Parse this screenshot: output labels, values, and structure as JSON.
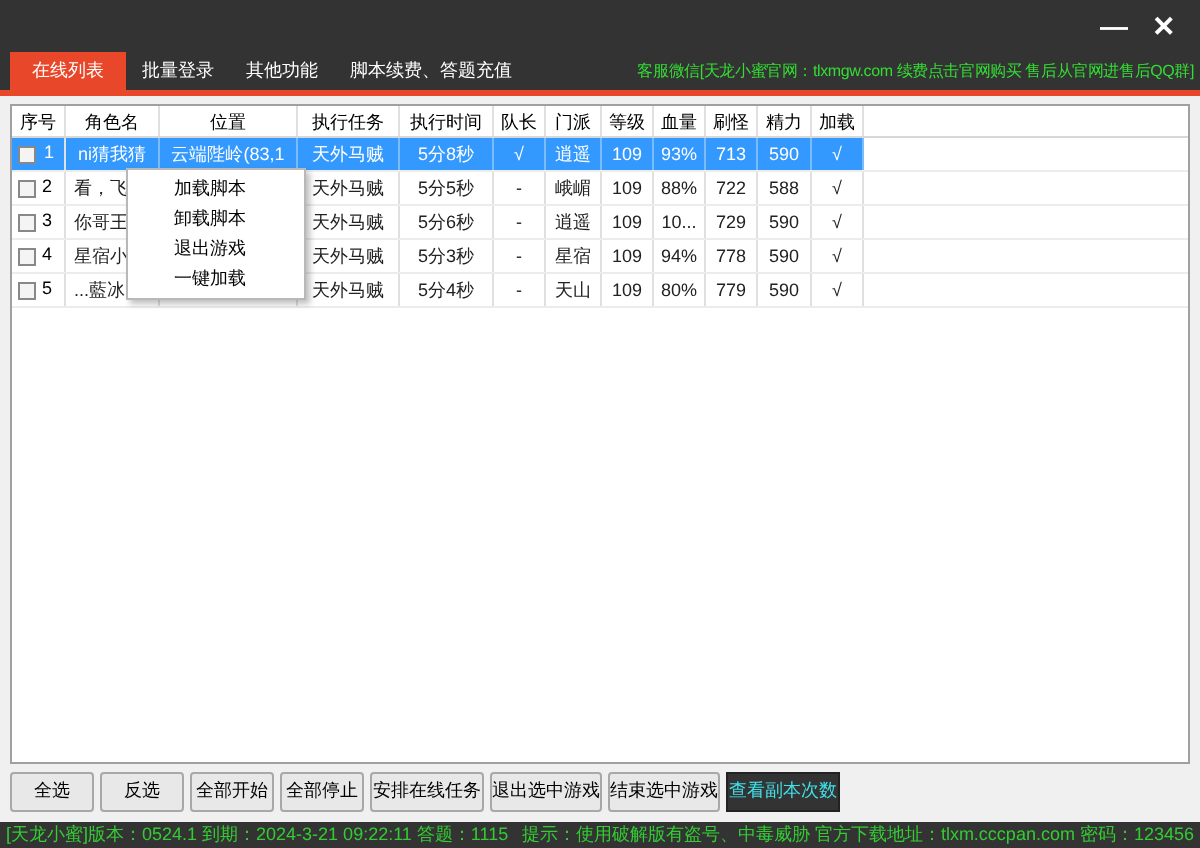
{
  "window": {
    "controls": [
      "—",
      "✕"
    ]
  },
  "tabs": [
    {
      "label": "在线列表",
      "selected": true
    },
    {
      "label": "批量登录",
      "selected": false
    },
    {
      "label": "其他功能",
      "selected": false
    },
    {
      "label": "脚本续费、答题充值",
      "selected": false
    }
  ],
  "notice": "客服微信[天龙小蜜官网：tlxmgw.com 续费点击官网购买 售后从官网进售后QQ群]",
  "table": {
    "columns": [
      "序号",
      "角色名",
      "位置",
      "执行任务",
      "执行时间",
      "队长",
      "门派",
      "等级",
      "血量",
      "刷怪",
      "精力",
      "加载"
    ],
    "rows": [
      {
        "selected": true,
        "checked": false,
        "cells": [
          "1",
          "ni猜我猜",
          "云端陛岭(83,1",
          "天外马贼",
          "5分8秒",
          "√",
          "逍遥",
          "109",
          "93%",
          "713",
          "590",
          "√"
        ]
      },
      {
        "selected": false,
        "checked": false,
        "cells": [
          "2",
          "看，飞",
          "",
          "天外马贼",
          "5分5秒",
          "-",
          "峨嵋",
          "109",
          "88%",
          "722",
          "588",
          "√"
        ]
      },
      {
        "selected": false,
        "checked": false,
        "cells": [
          "3",
          "你哥王",
          "",
          "天外马贼",
          "5分6秒",
          "-",
          "逍遥",
          "109",
          "10...",
          "729",
          "590",
          "√"
        ]
      },
      {
        "selected": false,
        "checked": false,
        "cells": [
          "4",
          "星宿小",
          "",
          "天外马贼",
          "5分3秒",
          "-",
          "星宿",
          "109",
          "94%",
          "778",
          "590",
          "√"
        ]
      },
      {
        "selected": false,
        "checked": false,
        "cells": [
          "5",
          "...藍冰",
          "",
          "天外马贼",
          "5分4秒",
          "-",
          "天山",
          "109",
          "80%",
          "779",
          "590",
          "√"
        ]
      }
    ]
  },
  "context_menu": [
    "加载脚本",
    "卸载脚本",
    "退出游戏",
    "一键加载"
  ],
  "buttons": [
    {
      "label": "全选",
      "highlighted": false
    },
    {
      "label": "反选",
      "highlighted": false
    },
    {
      "label": "全部开始",
      "highlighted": false
    },
    {
      "label": "全部停止",
      "highlighted": false
    },
    {
      "label": "安排在线任务",
      "highlighted": false
    },
    {
      "label": "退出选中游戏",
      "highlighted": false
    },
    {
      "label": "结束选中游戏",
      "highlighted": false
    },
    {
      "label": "查看副本次数",
      "highlighted": true
    }
  ],
  "status_bar": {
    "left": "[天龙小蜜]版本：0524.1  到期：2024-3-21 09:22:11  答题：1115",
    "right": "提示：使用破解版有盗号、中毒威胁 官方下载地址：tlxm.cccpan.com 密码：123456"
  }
}
